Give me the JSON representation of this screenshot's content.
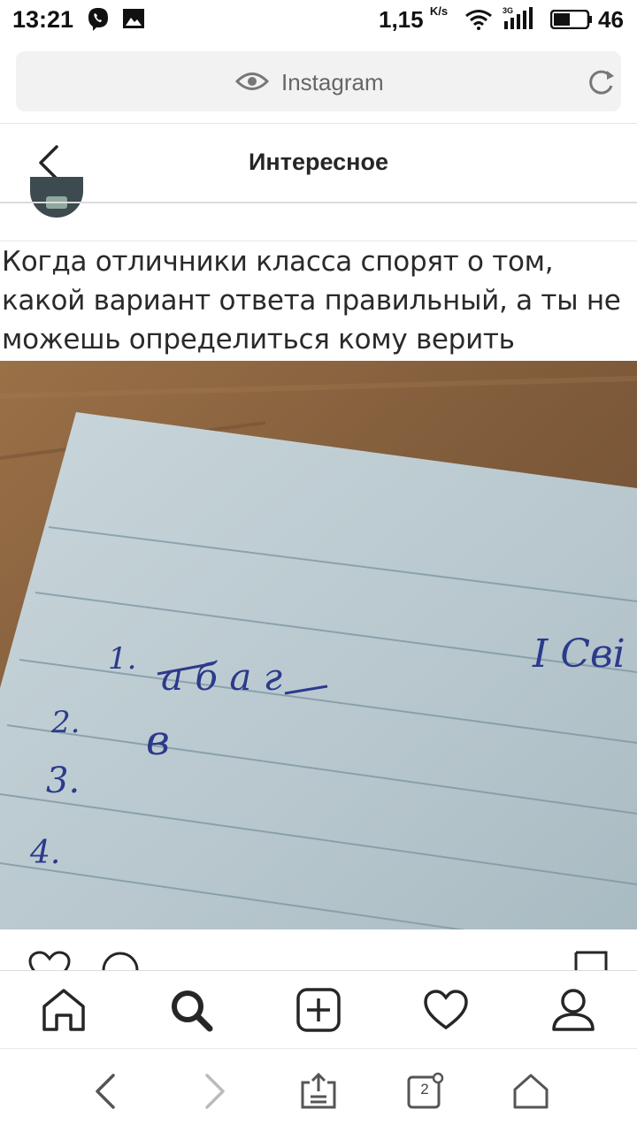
{
  "status_bar": {
    "time": "13:21",
    "network_speed": "1,15",
    "network_speed_unit": "K/s",
    "network_type": "3G",
    "battery": "46"
  },
  "browser": {
    "address_title": "Instagram",
    "tab_count": "2"
  },
  "header": {
    "title": "Интересное"
  },
  "post": {
    "caption": "Когда отличники класса спорят о том, какой вариант ответа правильный, а ты не можешь определиться кому верить больше:",
    "photo_handwriting": {
      "line1_number": "1.",
      "line1_text": "а б а г",
      "line2_number": "2.",
      "line2_text": "в",
      "line3_number": "3.",
      "line4_number": "4.",
      "corner_text": "I Cвi"
    }
  },
  "icons": {
    "status": [
      "viber-icon",
      "gallery-icon",
      "wifi-icon",
      "signal-icon",
      "battery-icon"
    ],
    "address": [
      "eye-icon",
      "reload-icon"
    ],
    "header": [
      "back-icon"
    ],
    "actions": [
      "heart-icon",
      "comment-icon",
      "bookmark-icon"
    ],
    "bottom_nav": [
      "home-icon",
      "search-icon",
      "add-post-icon",
      "activity-icon",
      "profile-icon"
    ],
    "browser_toolbar": [
      "browser-back-icon",
      "browser-forward-icon",
      "share-icon",
      "tabs-icon",
      "browser-home-icon"
    ]
  },
  "colors": {
    "text_primary": "#262626",
    "divider": "#dbdbdb",
    "address_bg": "#f2f2f2",
    "ink_blue": "#2c3a8c"
  }
}
